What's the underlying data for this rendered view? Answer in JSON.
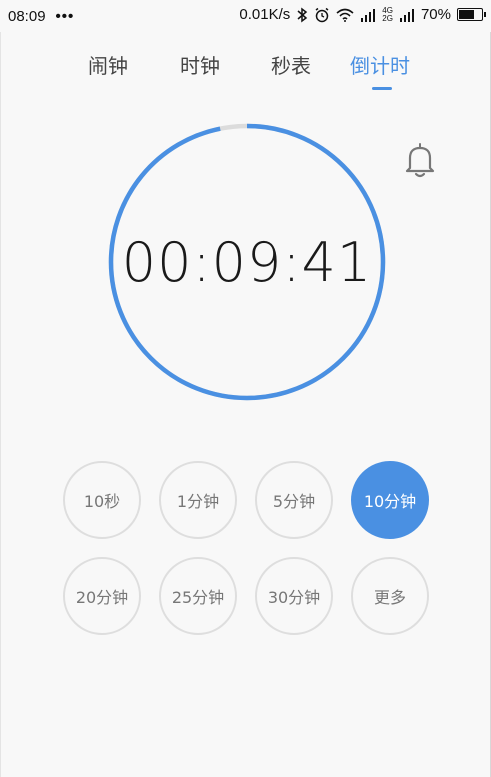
{
  "status_bar": {
    "time": "08:09",
    "dots": "•••",
    "net_speed": "0.01K/s",
    "net_type_top": "4G",
    "net_type_bottom": "2G",
    "battery": "70%",
    "battery_level": 0.7
  },
  "tabs": [
    {
      "label": "闹钟",
      "active": false
    },
    {
      "label": "时钟",
      "active": false
    },
    {
      "label": "秒表",
      "active": false
    },
    {
      "label": "倒计时",
      "active": true
    }
  ],
  "timer": {
    "display": "00:09:41",
    "progress_remaining": 0.968
  },
  "colors": {
    "accent": "#4a90e2",
    "ring_track": "#dcdcdc"
  },
  "presets": [
    {
      "label": "10秒",
      "selected": false
    },
    {
      "label": "1分钟",
      "selected": false
    },
    {
      "label": "5分钟",
      "selected": false
    },
    {
      "label": "10分钟",
      "selected": true
    },
    {
      "label": "20分钟",
      "selected": false
    },
    {
      "label": "25分钟",
      "selected": false
    },
    {
      "label": "30分钟",
      "selected": false
    },
    {
      "label": "更多",
      "selected": false
    }
  ]
}
